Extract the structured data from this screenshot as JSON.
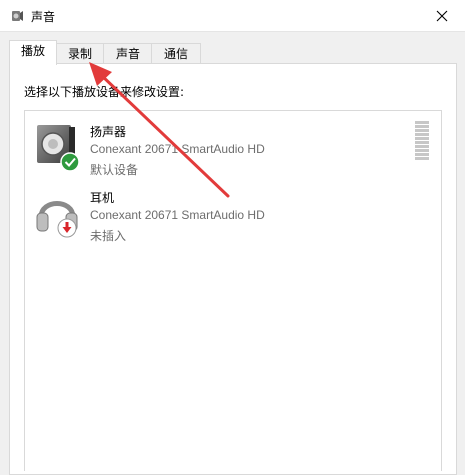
{
  "window": {
    "title": "声音"
  },
  "tabs": [
    {
      "label": "播放",
      "active": true
    },
    {
      "label": "录制",
      "active": false
    },
    {
      "label": "声音",
      "active": false
    },
    {
      "label": "通信",
      "active": false
    }
  ],
  "panel": {
    "instruction": "选择以下播放设备来修改设置:"
  },
  "devices": [
    {
      "name": "扬声器",
      "description": "Conexant 20671 SmartAudio HD",
      "status": "默认设备",
      "icon": "speaker-icon",
      "badge": "default-check-icon"
    },
    {
      "name": "耳机",
      "description": "Conexant 20671 SmartAudio HD",
      "status": "未插入",
      "icon": "headphones-icon",
      "badge": "unplugged-arrow-icon"
    }
  ],
  "colors": {
    "accent_check": "#2e9a3e",
    "unplugged_red": "#d9252a",
    "annotation_red": "#e23b3b"
  }
}
